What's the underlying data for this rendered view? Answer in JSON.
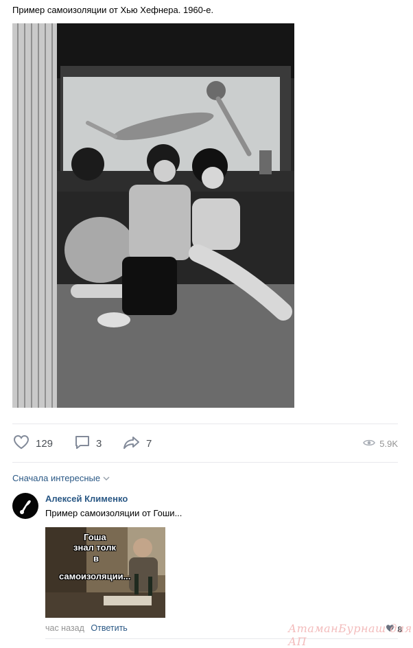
{
  "post": {
    "text": "Пример самоизоляции от Хью Хефнера. 1960-е."
  },
  "actions": {
    "likes": "129",
    "comments": "3",
    "shares": "7",
    "views": "5.9K"
  },
  "comments": {
    "sort_label": "Сначала интересные",
    "items": [
      {
        "author": "Алексей Клименко",
        "text": "Пример самоизоляции от Гоши...",
        "meme_lines": [
          "Гоша",
          "знал толк",
          "в",
          "самоизоляции..."
        ],
        "time": "час назад",
        "reply_label": "Ответить",
        "likes": "8"
      }
    ]
  },
  "watermark": "АтаманБурнаш для АП",
  "colors": {
    "link": "#2a5885",
    "muted": "#939393",
    "icon": "#828a99",
    "divider": "#e7e8ec"
  }
}
